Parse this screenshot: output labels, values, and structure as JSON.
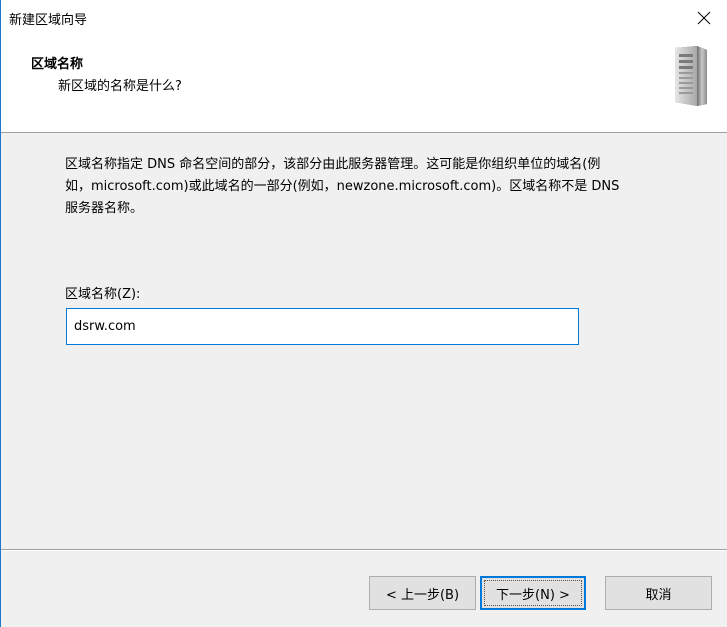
{
  "window": {
    "title": "新建区域向导",
    "close_symbol": "✕"
  },
  "header": {
    "title": "区域名称",
    "subtitle": "新区域的名称是什么?",
    "icon": "server-tower-icon"
  },
  "main": {
    "description_line1": "区域名称指定 DNS 命名空间的部分，该部分由此服务器管理。这可能是你组织单位的域名(例",
    "description_line2": "如，microsoft.com)或此域名的一部分(例如，newzone.microsoft.com)。区域名称不是 DNS",
    "description_line3": "服务器名称。",
    "zone_name_label": "区域名称(Z):",
    "zone_name_value": "dsrw.com"
  },
  "buttons": {
    "back": "< 上一步(B)",
    "next": "下一步(N) >",
    "cancel": "取消"
  },
  "colors": {
    "accent": "#0078d7",
    "background": "#f0f0f0",
    "header_background": "#ffffff"
  }
}
